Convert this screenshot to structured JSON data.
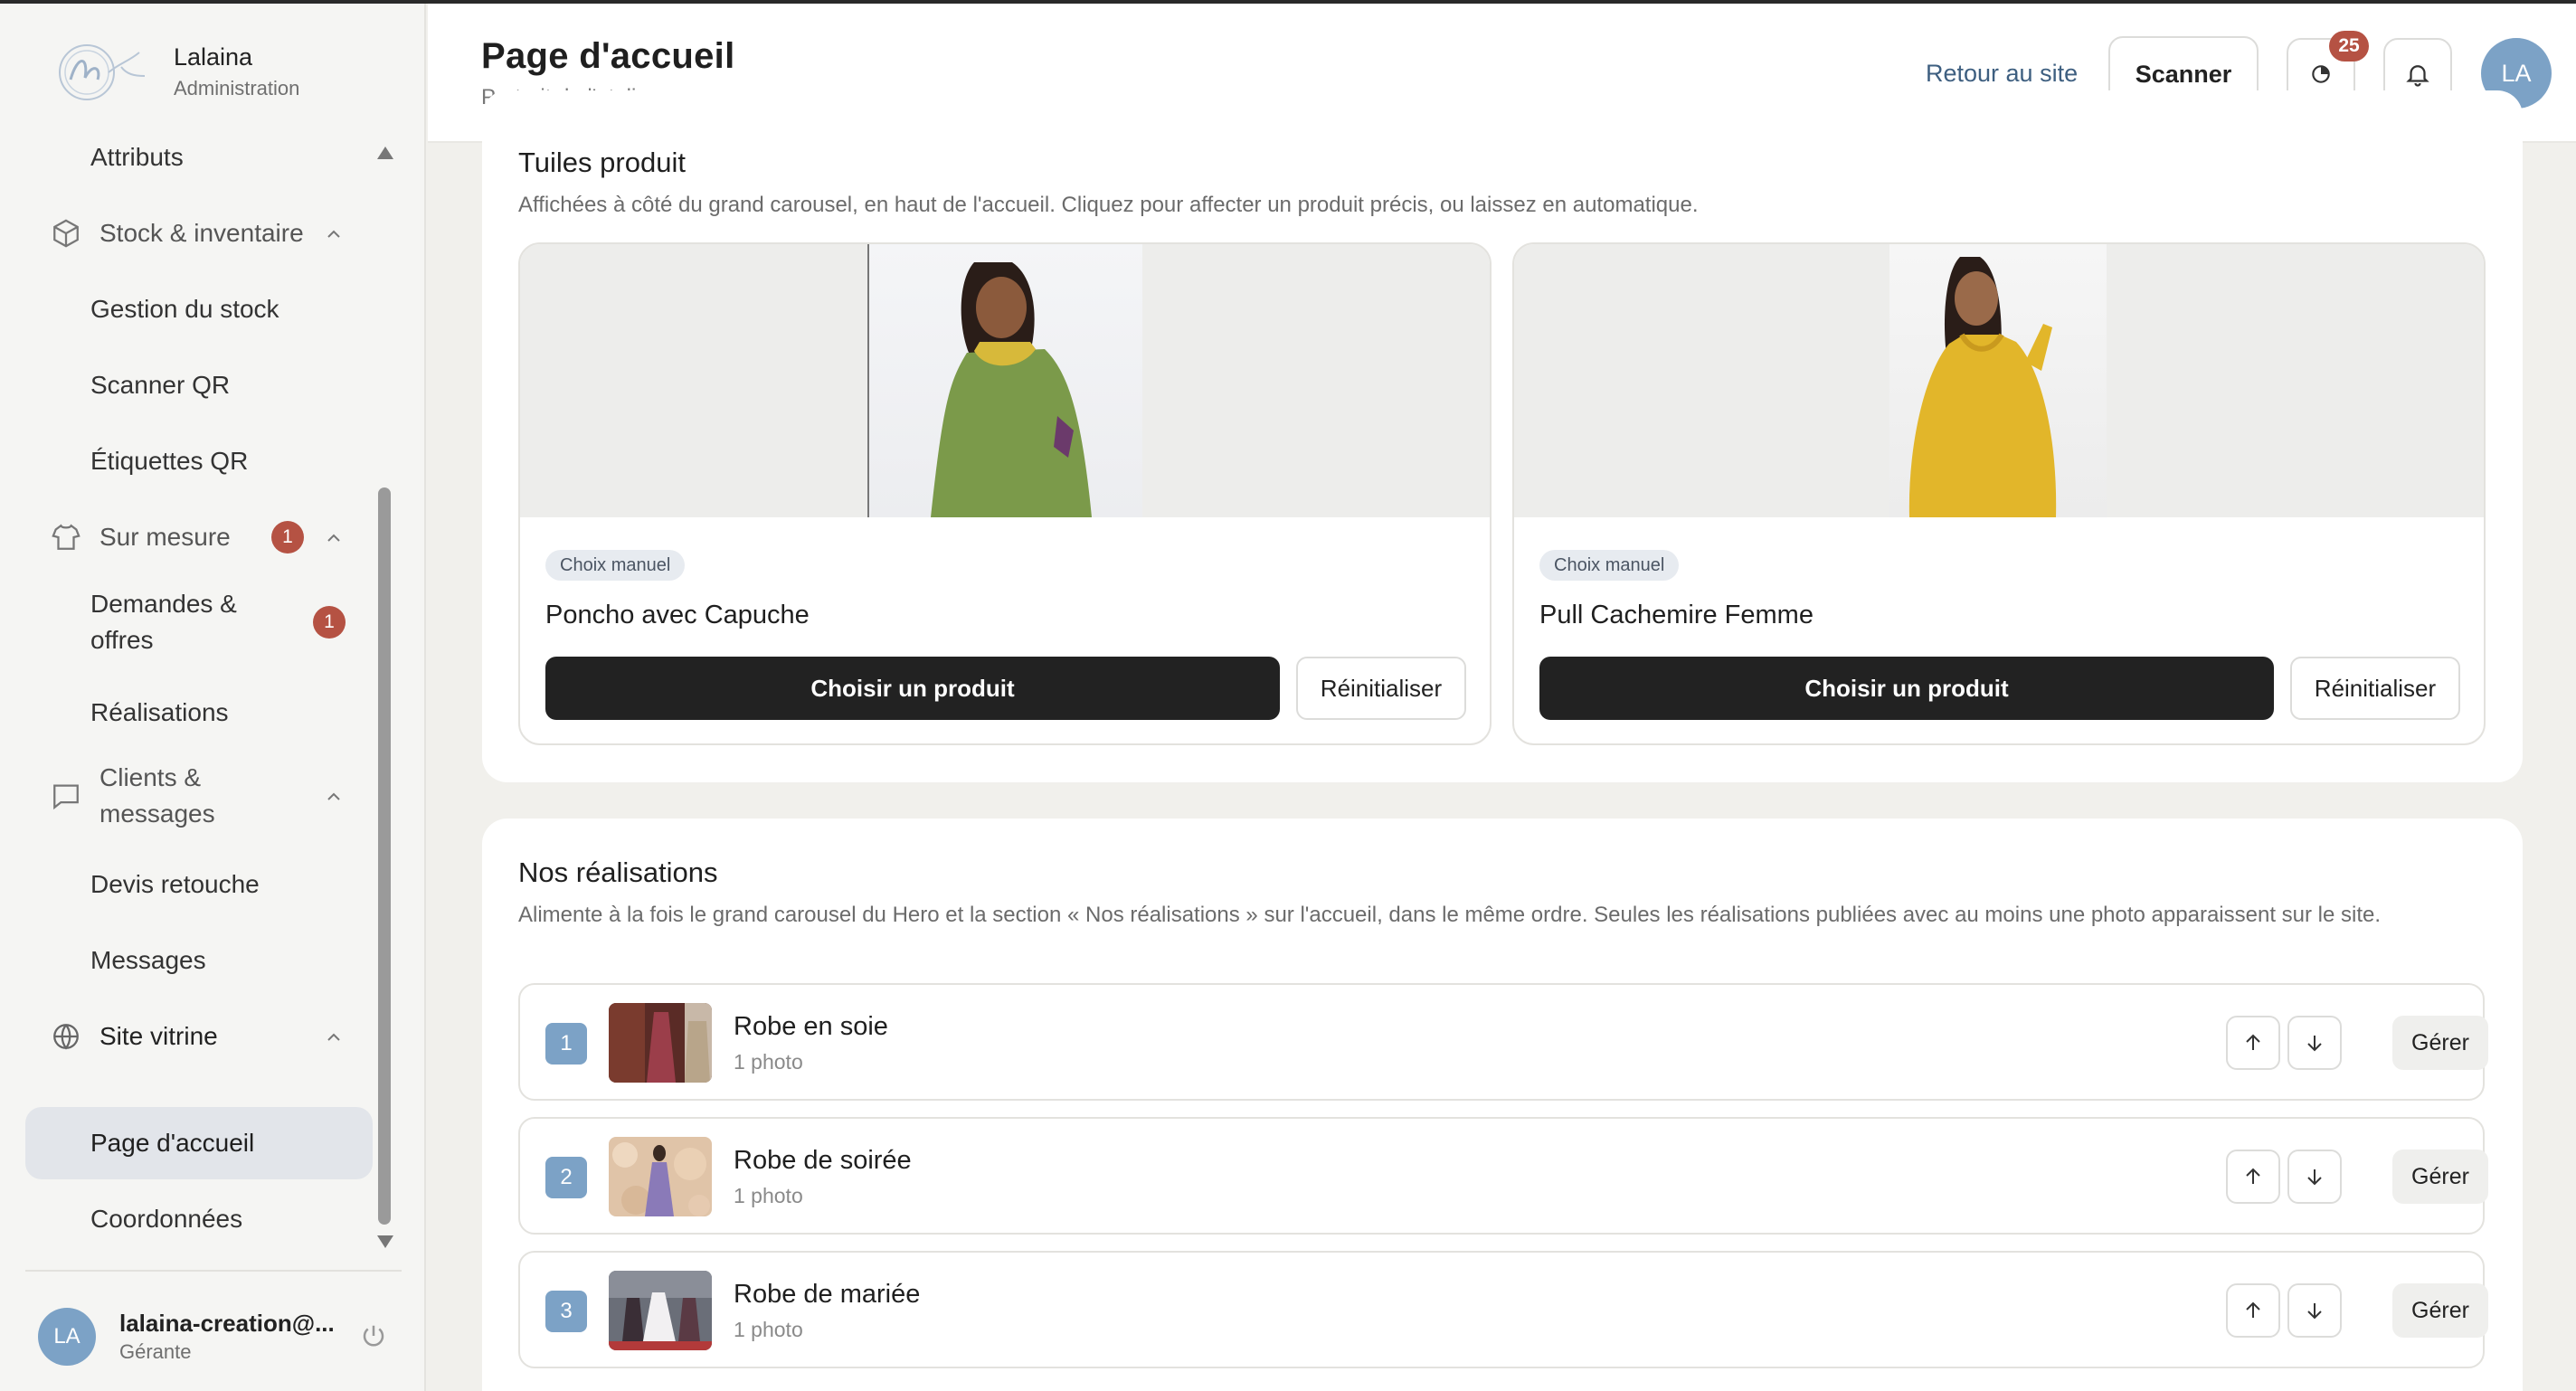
{
  "sidebar": {
    "brand_name": "Lalaina",
    "brand_sub": "Administration",
    "items": {
      "attributs": "Attributs",
      "stock_group": "Stock & inventaire",
      "gestion_stock": "Gestion du stock",
      "scanner_qr": "Scanner QR",
      "etiquettes_qr": "Étiquettes QR",
      "sur_mesure_group": "Sur mesure",
      "sur_mesure_badge": "1",
      "demandes_line1": "Demandes &",
      "demandes_line2": "offres",
      "demandes_badge": "1",
      "realisations": "Réalisations",
      "clients_line1": "Clients &",
      "clients_line2": "messages",
      "devis": "Devis retouche",
      "messages": "Messages",
      "site_group": "Site vitrine",
      "page_accueil": "Page d'accueil",
      "coordonnees": "Coordonnées"
    },
    "user": {
      "initials": "LA",
      "email": "lalaina-creation@...",
      "role": "Gérante"
    }
  },
  "header": {
    "title": "Page d'accueil",
    "subtitle": "Portrait de l'atelier",
    "back_link": "Retour au site",
    "scan_button": "Scanner",
    "history_badge": "25",
    "avatar": "LA"
  },
  "tiles_section": {
    "title": "Tuiles produit",
    "description": "Affichées à côté du grand carousel, en haut de l'accueil. Cliquez pour affecter un produit précis, ou laissez en automatique.",
    "tiles": [
      {
        "chip": "Choix manuel",
        "name": "Poncho avec Capuche",
        "choose": "Choisir un produit",
        "reset": "Réinitialiser"
      },
      {
        "chip": "Choix manuel",
        "name": "Pull Cachemire Femme",
        "choose": "Choisir un produit",
        "reset": "Réinitialiser"
      }
    ]
  },
  "realisations_section": {
    "title": "Nos réalisations",
    "description": "Alimente à la fois le grand carousel du Hero et la section « Nos réalisations » sur l'accueil, dans le même ordre. Seules les réalisations publiées avec au moins une photo apparaissent sur le site.",
    "rows": [
      {
        "num": "1",
        "title": "Robe en soie",
        "photos": "1 photo",
        "manage": "Gérer"
      },
      {
        "num": "2",
        "title": "Robe de soirée",
        "photos": "1 photo",
        "manage": "Gérer"
      },
      {
        "num": "3",
        "title": "Robe de mariée",
        "photos": "1 photo",
        "manage": "Gérer"
      }
    ]
  },
  "colors": {
    "accent_blue": "#7ca2c6",
    "badge_red": "#b55243",
    "primary_dark": "#222222",
    "link_blue": "#3e5f80"
  },
  "icons": [
    "logo-icon",
    "box-icon",
    "shirt-icon",
    "chat-icon",
    "globe-icon",
    "chevron-up-icon",
    "power-icon",
    "history-icon",
    "bell-icon",
    "arrow-up-icon",
    "arrow-down-icon"
  ]
}
